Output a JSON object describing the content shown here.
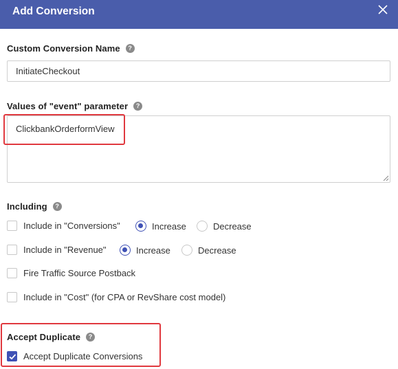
{
  "dialog": {
    "title": "Add Conversion",
    "close_icon": "close-icon"
  },
  "name_field": {
    "label": "Custom Conversion Name",
    "value": "InitiateCheckout"
  },
  "event_field": {
    "label": "Values of \"event\" parameter",
    "value": "ClickbankOrderformView"
  },
  "including": {
    "label": "Including",
    "options": [
      {
        "label": "Include in \"Conversions\"",
        "checked": false,
        "radios": [
          {
            "label": "Increase",
            "selected": true
          },
          {
            "label": "Decrease",
            "selected": false
          }
        ]
      },
      {
        "label": "Include in \"Revenue\"",
        "checked": false,
        "radios": [
          {
            "label": "Increase",
            "selected": true
          },
          {
            "label": "Decrease",
            "selected": false
          }
        ]
      },
      {
        "label": "Fire Traffic Source Postback",
        "checked": false
      },
      {
        "label": "Include in \"Cost\" (for CPA or RevShare cost model)",
        "checked": false
      }
    ]
  },
  "duplicate": {
    "label": "Accept Duplicate",
    "option_label": "Accept Duplicate Conversions",
    "checked": true
  },
  "help_icon_glyph": "?",
  "colors": {
    "header": "#4a5dab",
    "accent": "#3f51b5",
    "highlight": "#e0383e"
  }
}
